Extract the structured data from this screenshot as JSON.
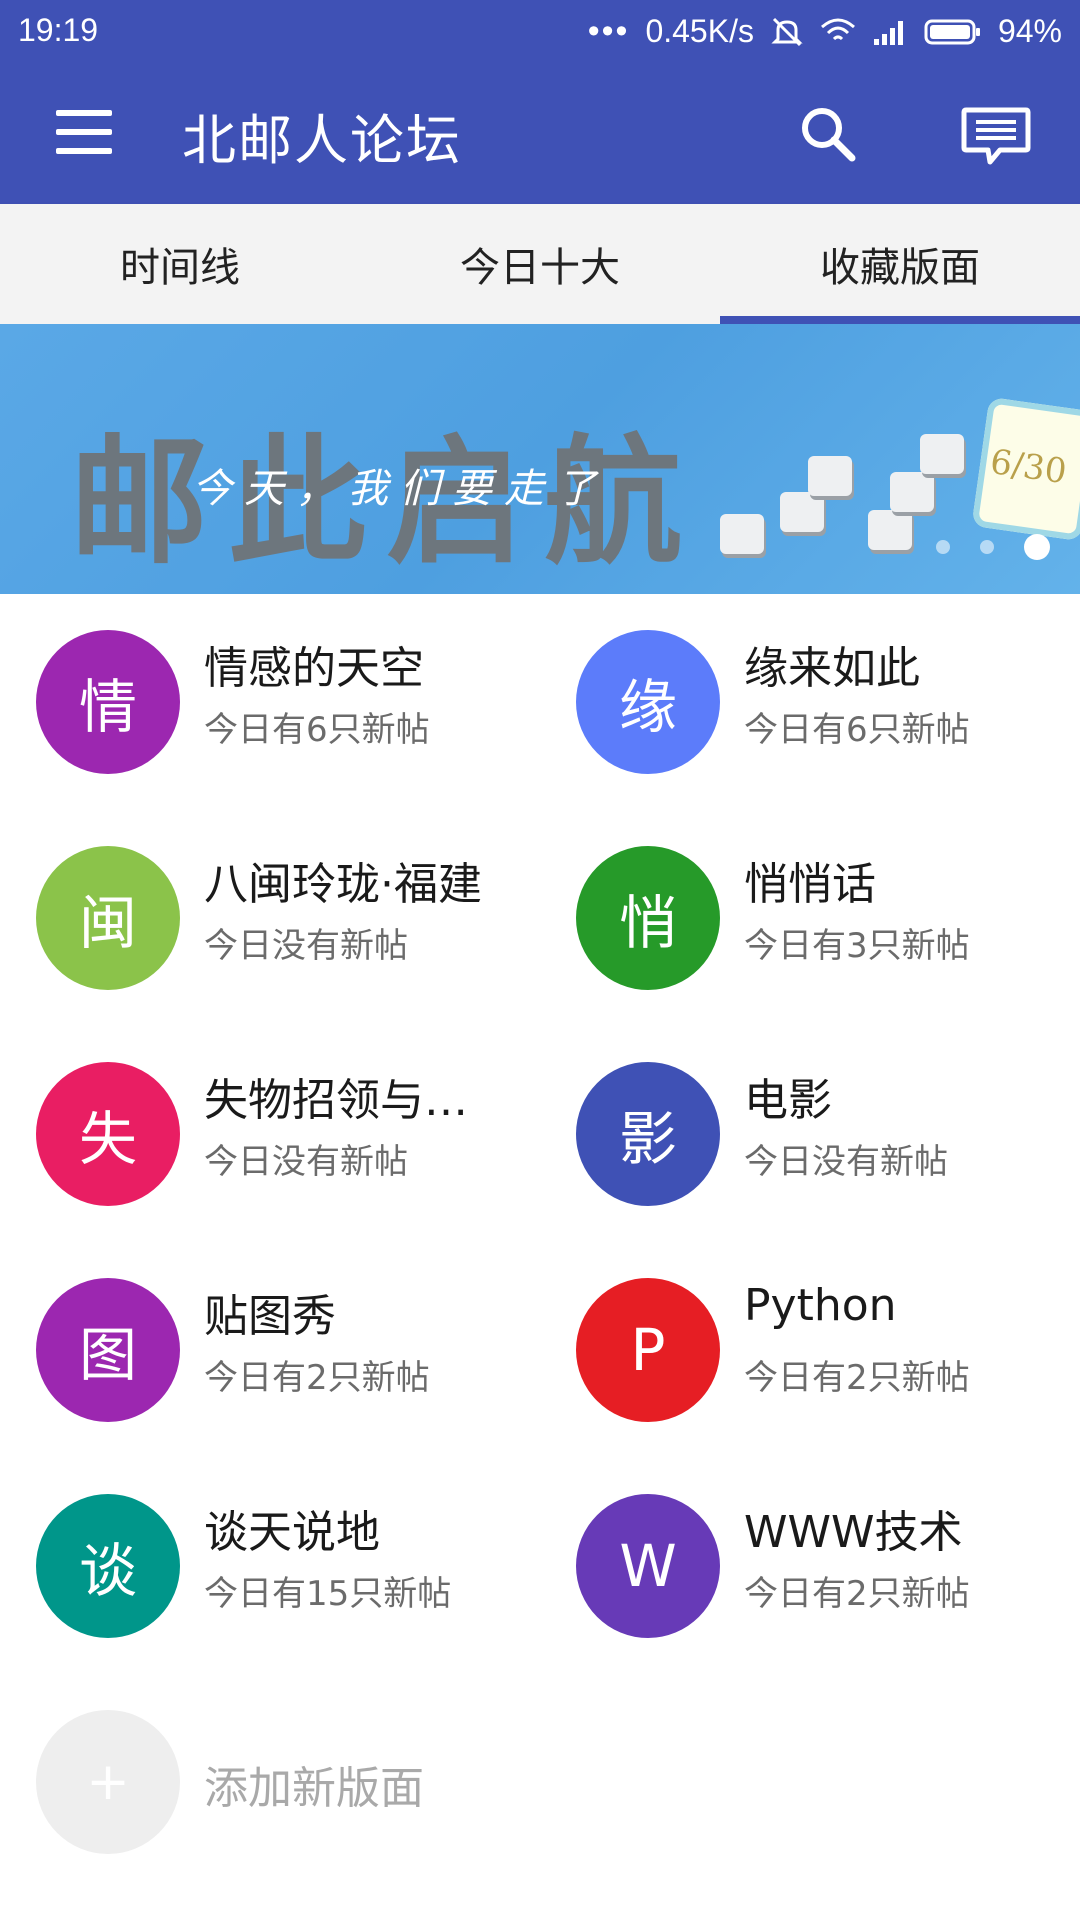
{
  "status_bar": {
    "time": "19:19",
    "network_speed": "0.45K/s",
    "battery": "94%"
  },
  "app_bar": {
    "title": "北邮人论坛",
    "icons": [
      "menu-icon",
      "search-icon",
      "message-icon"
    ]
  },
  "tabs": [
    {
      "label": "时间线",
      "active": false
    },
    {
      "label": "今日十大",
      "active": false
    },
    {
      "label": "收藏版面",
      "active": true
    }
  ],
  "banner": {
    "headline": "邮此启航",
    "subtitle": "今天，我们要走了",
    "calendar_text": "6/30",
    "page_count": 3,
    "active_page": 3
  },
  "boards": [
    {
      "avatar_char": "情",
      "color": "#9c27b0",
      "name": "情感的天空",
      "today": "今日有6只新帖"
    },
    {
      "avatar_char": "缘",
      "color": "#5c7cfa",
      "name": "缘来如此",
      "today": "今日有6只新帖"
    },
    {
      "avatar_char": "闽",
      "color": "#8bc34a",
      "name": "八闽玲珑·福建",
      "today": "今日没有新帖"
    },
    {
      "avatar_char": "悄",
      "color": "#269a29",
      "name": "悄悄话",
      "today": "今日有3只新帖"
    },
    {
      "avatar_char": "失",
      "color": "#e91e63",
      "name": "失物招领与拾…",
      "today": "今日没有新帖"
    },
    {
      "avatar_char": "影",
      "color": "#3f51b5",
      "name": "电影",
      "today": "今日没有新帖"
    },
    {
      "avatar_char": "图",
      "color": "#9c27b0",
      "name": "贴图秀",
      "today": "今日有2只新帖"
    },
    {
      "avatar_char": "P",
      "color": "#e61e24",
      "name": "Python",
      "today": "今日有2只新帖"
    },
    {
      "avatar_char": "谈",
      "color": "#00968a",
      "name": "谈天说地",
      "today": "今日有15只新帖"
    },
    {
      "avatar_char": "W",
      "color": "#673ab7",
      "name": "WWW技术",
      "today": "今日有2只新帖"
    }
  ],
  "add_board": {
    "icon": "+",
    "label": "添加新版面"
  }
}
